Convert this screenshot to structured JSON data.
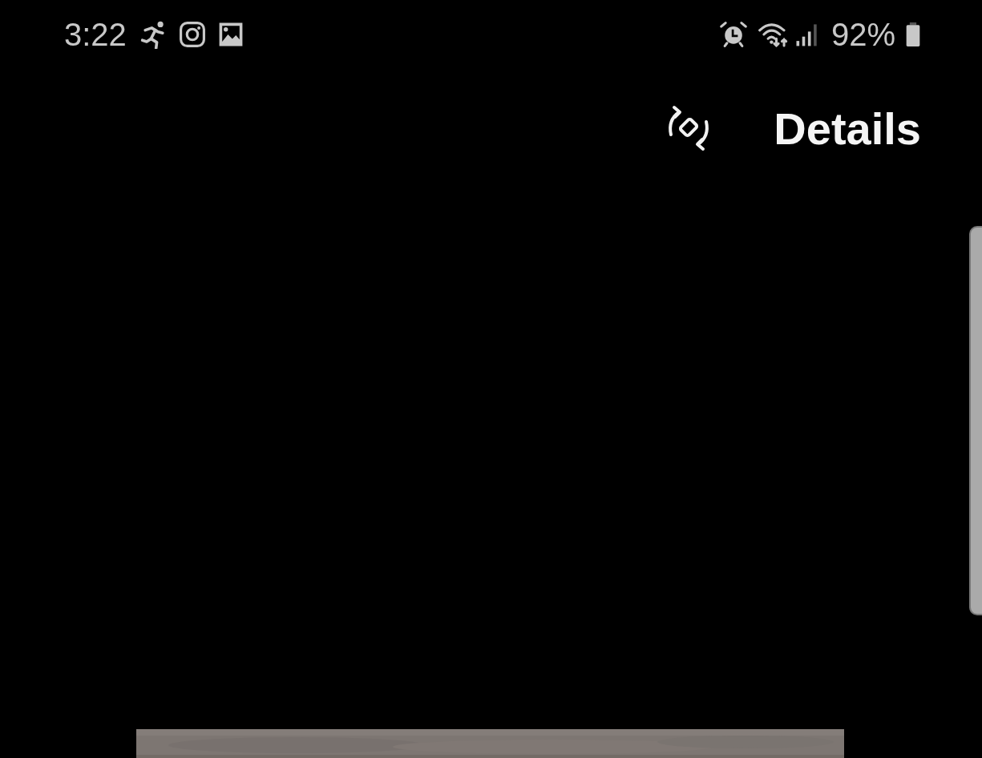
{
  "status_bar": {
    "time": "3:22",
    "battery": "92%"
  },
  "toolbar": {
    "action": "Details"
  }
}
